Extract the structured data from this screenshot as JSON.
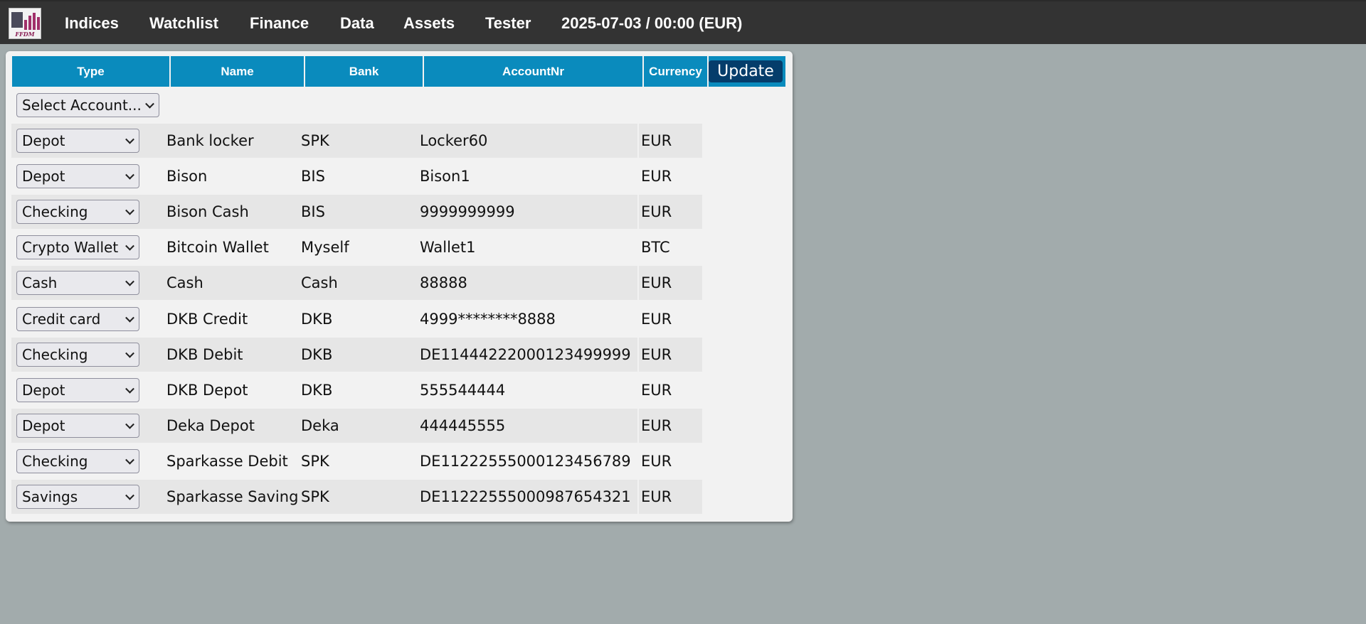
{
  "app": {
    "logo_text": "FFDM",
    "nav": [
      "Indices",
      "Watchlist",
      "Finance",
      "Data",
      "Assets",
      "Tester"
    ],
    "date_status": "2025-07-03 / 00:00 (EUR)"
  },
  "table": {
    "headers": {
      "type": "Type",
      "name": "Name",
      "bank": "Bank",
      "account_nr": "AccountNr",
      "currency": "Currency"
    },
    "update_label": "Update",
    "select_account": "Select Account...",
    "rows": [
      {
        "type": "Depot",
        "name": "Bank locker",
        "bank": "SPK",
        "account_nr": "Locker60",
        "currency": "EUR"
      },
      {
        "type": "Depot",
        "name": "Bison",
        "bank": "BIS",
        "account_nr": "Bison1",
        "currency": "EUR"
      },
      {
        "type": "Checking",
        "name": "Bison Cash",
        "bank": "BIS",
        "account_nr": "9999999999",
        "currency": "EUR"
      },
      {
        "type": "Crypto Wallet",
        "name": "Bitcoin Wallet",
        "bank": "Myself",
        "account_nr": "Wallet1",
        "currency": "BTC"
      },
      {
        "type": "Cash",
        "name": "Cash",
        "bank": "Cash",
        "account_nr": "88888",
        "currency": "EUR"
      },
      {
        "type": "Credit card",
        "name": "DKB Credit",
        "bank": "DKB",
        "account_nr": "4999********8888",
        "currency": "EUR"
      },
      {
        "type": "Checking",
        "name": "DKB Debit",
        "bank": "DKB",
        "account_nr": "DE11444222000123499999",
        "currency": "EUR"
      },
      {
        "type": "Depot",
        "name": "DKB Depot",
        "bank": "DKB",
        "account_nr": "555544444",
        "currency": "EUR"
      },
      {
        "type": "Depot",
        "name": "Deka Depot",
        "bank": "Deka",
        "account_nr": "444445555",
        "currency": "EUR"
      },
      {
        "type": "Checking",
        "name": "Sparkasse Debit",
        "bank": "SPK",
        "account_nr": "DE11222555000123456789",
        "currency": "EUR"
      },
      {
        "type": "Savings",
        "name": "Sparkasse Saving",
        "bank": "SPK",
        "account_nr": "DE11222555000987654321",
        "currency": "EUR"
      }
    ]
  },
  "colors": {
    "topbar": "#333333",
    "page_background": "#a2abac",
    "header_blue": "#0a8bbd",
    "update_button": "#053d6b",
    "row_stripe": "#e6e6e6",
    "panel": "#f2f2f2"
  }
}
